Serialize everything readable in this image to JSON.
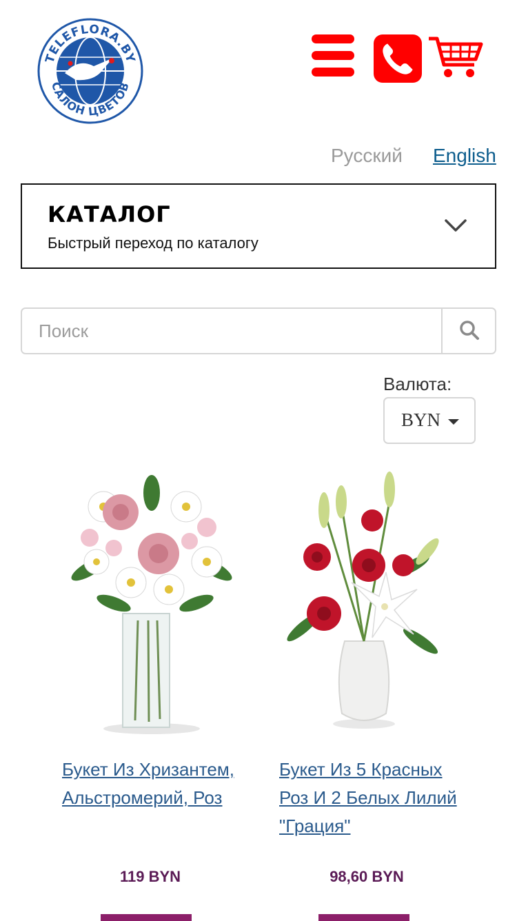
{
  "header": {
    "logo_text_top": "TELEFLORA.BY",
    "logo_text_bottom": "САЛОН ЦВЕТОВ",
    "menu_icon": "hamburger-icon",
    "phone_icon": "phone-icon",
    "cart_icon": "cart-icon",
    "accent_color": "#ff0000"
  },
  "languages": {
    "ru": "Русский",
    "en": "English"
  },
  "catalog": {
    "title": "КАТАЛОГ",
    "subtitle": "Быстрый переход по каталогу"
  },
  "search": {
    "placeholder": "Поиск",
    "value": ""
  },
  "currency": {
    "label": "Валюта:",
    "selected": "BYN"
  },
  "products": [
    {
      "title": "Букет Из Хризантем, Альстромерий, Роз",
      "price": "119 BYN"
    },
    {
      "title": "Букет Из 5 Красных Роз И 2 Белых Лилий \"Грация\"",
      "price": "98,60 BYN"
    }
  ]
}
